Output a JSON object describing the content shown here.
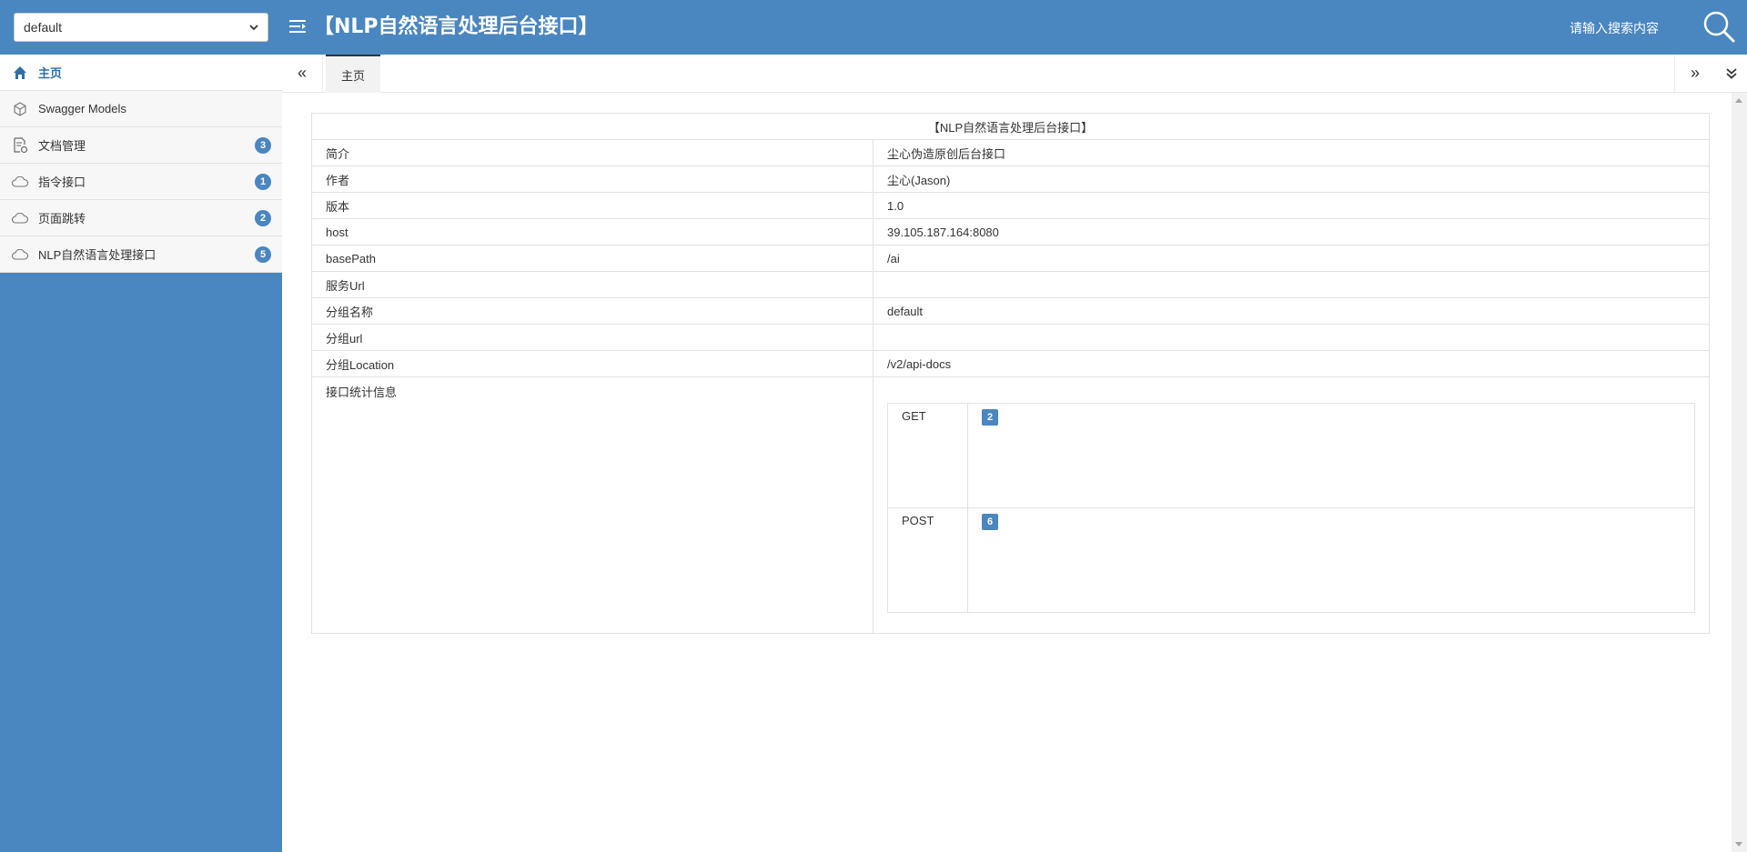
{
  "header": {
    "group_select_value": "default",
    "title": "【NLP自然语言处理后台接口】",
    "search_placeholder": "请输入搜索内容"
  },
  "sidebar": {
    "items": [
      {
        "label": "主页",
        "icon": "home-icon",
        "badge": ""
      },
      {
        "label": "Swagger Models",
        "icon": "cube-icon",
        "badge": ""
      },
      {
        "label": "文档管理",
        "icon": "document-gear-icon",
        "badge": "3"
      },
      {
        "label": "指令接口",
        "icon": "cloud-api-icon",
        "badge": "1"
      },
      {
        "label": "页面跳转",
        "icon": "cloud-api-icon",
        "badge": "2"
      },
      {
        "label": "NLP自然语言处理接口",
        "icon": "cloud-api-icon",
        "badge": "5"
      }
    ]
  },
  "tabs": {
    "home_label": "主页",
    "prev_icon": "«",
    "next_icon": "»",
    "more_icon": "chevron-double-down-icon"
  },
  "info": {
    "title": "【NLP自然语言处理后台接口】",
    "rows": [
      {
        "key": "简介",
        "value": "尘心伪造原创后台接口"
      },
      {
        "key": "作者",
        "value": "尘心(Jason)"
      },
      {
        "key": "版本",
        "value": "1.0"
      },
      {
        "key": "host",
        "value": "39.105.187.164:8080"
      },
      {
        "key": "basePath",
        "value": "/ai"
      },
      {
        "key": "服务Url",
        "value": ""
      },
      {
        "key": "分组名称",
        "value": "default"
      },
      {
        "key": "分组url",
        "value": ""
      },
      {
        "key": "分组Location",
        "value": "/v2/api-docs"
      }
    ],
    "stats_label": "接口统计信息",
    "stats": [
      {
        "method": "GET",
        "count": "2"
      },
      {
        "method": "POST",
        "count": "6"
      }
    ]
  },
  "colors": {
    "primary": "#4a86c0",
    "active_text": "#2f6ea6"
  }
}
